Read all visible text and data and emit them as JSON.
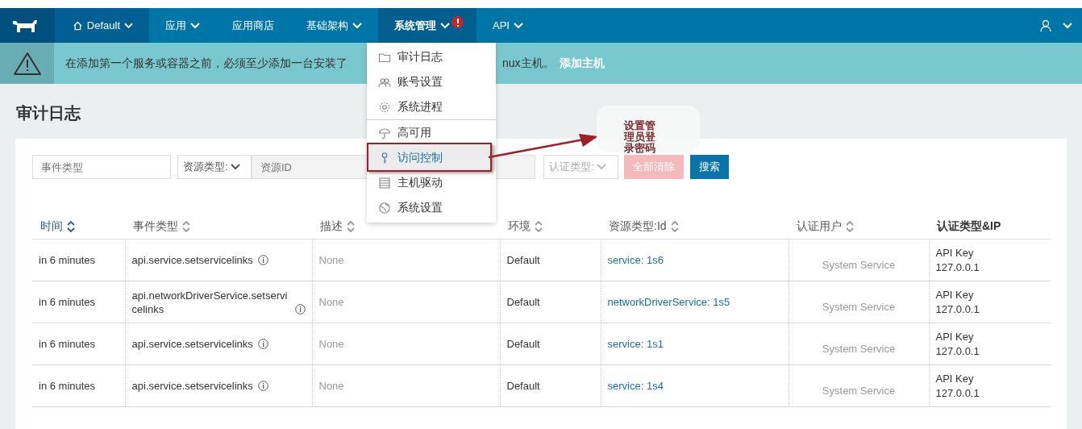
{
  "nav": {
    "items": [
      {
        "label": "Default",
        "kind": "env",
        "caret": true,
        "selected": false,
        "alert": false
      },
      {
        "label": "应用",
        "kind": "menu",
        "caret": true,
        "selected": false,
        "alert": false
      },
      {
        "label": "应用商店",
        "kind": "menu",
        "caret": false,
        "selected": false,
        "alert": false
      },
      {
        "label": "基础架构",
        "kind": "menu",
        "caret": true,
        "selected": false,
        "alert": false
      },
      {
        "label": "系统管理",
        "kind": "menu",
        "caret": true,
        "selected": true,
        "alert": true
      },
      {
        "label": "API",
        "kind": "menu",
        "caret": true,
        "selected": false,
        "alert": false
      }
    ]
  },
  "banner": {
    "text_before": "在添加第一个服务或容器之前，必须至少添加一台安装了",
    "text_after": "nux主机。",
    "link": "添加主机"
  },
  "dropdown": {
    "items": [
      {
        "label": "审计日志",
        "selected": false,
        "divider_before": false
      },
      {
        "label": "账号设置",
        "selected": false,
        "divider_before": false
      },
      {
        "label": "系统进程",
        "selected": false,
        "divider_before": false
      },
      {
        "label": "高可用",
        "selected": false,
        "divider_before": true
      },
      {
        "label": "访问控制",
        "selected": true,
        "divider_before": false
      },
      {
        "label": "主机驱动",
        "selected": false,
        "divider_before": false
      },
      {
        "label": "系统设置",
        "selected": false,
        "divider_before": false
      }
    ]
  },
  "callout": {
    "text": "设置管理员登录密码"
  },
  "page_title": "审计日志",
  "filters": {
    "event_type": {
      "placeholder": "事件类型"
    },
    "resource_type": {
      "label": "资源类型:"
    },
    "resource_id": {
      "placeholder": "资源ID"
    },
    "auth_type": {
      "label": "认证类型:"
    },
    "clear_button": "全部清除",
    "search_button": "搜索"
  },
  "table": {
    "columns": [
      {
        "label": "时间",
        "sortable": true,
        "selected": true
      },
      {
        "label": "事件类型",
        "sortable": true,
        "selected": false
      },
      {
        "label": "描述",
        "sortable": true,
        "selected": false
      },
      {
        "label": "环境",
        "sortable": true,
        "selected": false
      },
      {
        "label": "资源类型:Id",
        "sortable": true,
        "selected": false
      },
      {
        "label": "认证用户",
        "sortable": true,
        "selected": false
      },
      {
        "label": "认证类型&IP",
        "sortable": false,
        "selected": false
      }
    ],
    "rows": [
      {
        "time": "in 6 minutes",
        "event": "api.service.setservicelinks",
        "description": "None",
        "environment": "Default",
        "resource": "service: 1s6",
        "user": "System Service",
        "auth_type": "API Key",
        "ip": "127.0.0.1"
      },
      {
        "time": "in 6 minutes",
        "event": "api.networkDriverService.setservicelinks",
        "description": "None",
        "environment": "Default",
        "resource": "networkDriverService: 1s5",
        "user": "System Service",
        "auth_type": "API Key",
        "ip": "127.0.0.1"
      },
      {
        "time": "in 6 minutes",
        "event": "api.service.setservicelinks",
        "description": "None",
        "environment": "Default",
        "resource": "service: 1s1",
        "user": "System Service",
        "auth_type": "API Key",
        "ip": "127.0.0.1"
      },
      {
        "time": "in 6 minutes",
        "event": "api.service.setservicelinks",
        "description": "None",
        "environment": "Default",
        "resource": "service: 1s4",
        "user": "System Service",
        "auth_type": "API Key",
        "ip": "127.0.0.1"
      }
    ]
  }
}
